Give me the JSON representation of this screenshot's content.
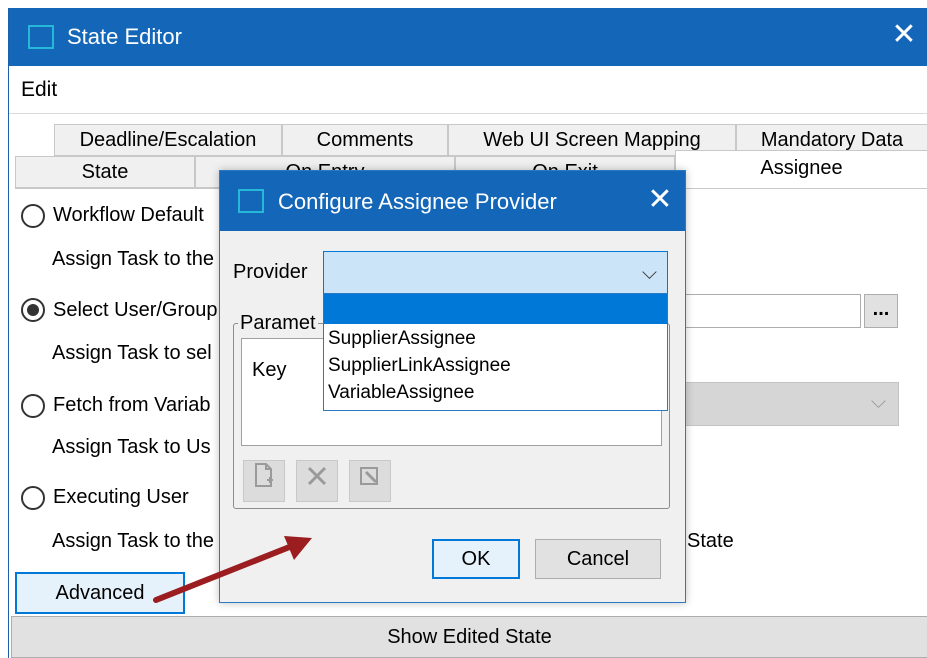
{
  "window": {
    "title": "State Editor",
    "close_glyph": "✕",
    "menu": [
      "Edit"
    ]
  },
  "tabs_row1": [
    "Deadline/Escalation",
    "Comments",
    "Web UI Screen Mapping",
    "Mandatory Data"
  ],
  "tabs_row2": [
    "State",
    "On Entry",
    "On Exit",
    "Assignee"
  ],
  "active_tab": "Assignee",
  "options": [
    {
      "label": "Workflow Default",
      "desc": "Assign Task to the",
      "checked": false
    },
    {
      "label": "Select User/Group",
      "desc": "Assign Task to sel",
      "checked": true
    },
    {
      "label": "Fetch from Variab",
      "desc": "Assign Task to Us",
      "checked": false
    },
    {
      "label": "Executing User",
      "desc": "Assign Task to the",
      "checked": false
    }
  ],
  "browse_button": "...",
  "state_suffix": "State",
  "advanced_button": "Advanced",
  "show_edited_state_button": "Show Edited State",
  "dialog": {
    "title": "Configure Assignee Provider",
    "close_glyph": "✕",
    "provider_label": "Provider",
    "provider_value": "",
    "chevron": "⌵",
    "dropdown_options": [
      "",
      "SupplierAssignee",
      "SupplierLinkAssignee",
      "VariableAssignee"
    ],
    "parameters_legend": "Paramet",
    "grid_header": "Key",
    "ok": "OK",
    "cancel": "Cancel"
  },
  "colors": {
    "titlebar": "#1467b8",
    "accent": "#0078d7",
    "arrow": "#9b1d20"
  }
}
